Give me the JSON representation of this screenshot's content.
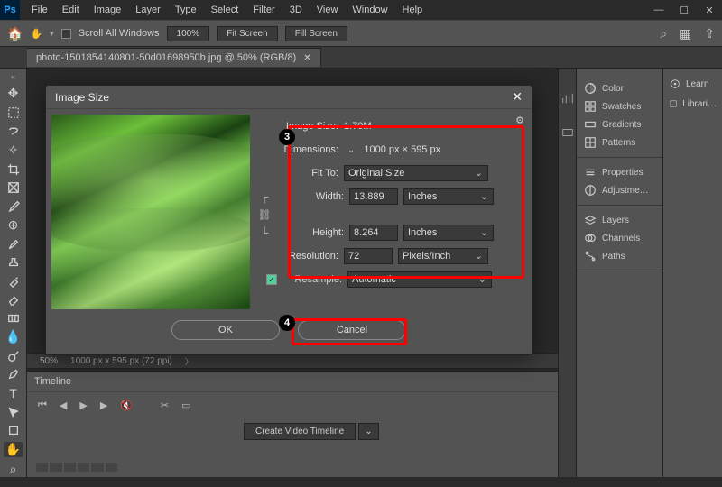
{
  "menu": [
    "File",
    "Edit",
    "Image",
    "Layer",
    "Type",
    "Select",
    "Filter",
    "3D",
    "View",
    "Window",
    "Help"
  ],
  "optbar": {
    "scroll_all": "Scroll All Windows",
    "zoom": "100%",
    "fit": "Fit Screen",
    "fill": "Fill Screen"
  },
  "tab": {
    "label": "photo-1501854140801-50d01698950b.jpg @ 50% (RGB/8)"
  },
  "dialog": {
    "title": "Image Size",
    "image_size_lbl": "Image Size:",
    "image_size_val": "1.70M",
    "dimensions_lbl": "Dimensions:",
    "dimensions_val": "1000 px × 595 px",
    "fit_lbl": "Fit To:",
    "fit_val": "Original Size",
    "width_lbl": "Width:",
    "width_val": "13.889",
    "height_lbl": "Height:",
    "height_val": "8.264",
    "unit_wh": "Inches",
    "res_lbl": "Resolution:",
    "res_val": "72",
    "res_unit": "Pixels/Inch",
    "resample_lbl": "Resample:",
    "resample_val": "Automatic",
    "ok": "OK",
    "cancel": "Cancel"
  },
  "zoombar": {
    "zoom": "50%",
    "info": "1000 px x 595 px (72 ppi)"
  },
  "timeline": {
    "title": "Timeline",
    "create": "Create Video Timeline"
  },
  "right": {
    "group1": [
      "Color",
      "Swatches",
      "Gradients",
      "Patterns"
    ],
    "group2": [
      "Properties",
      "Adjustme…"
    ],
    "group3": [
      "Layers",
      "Channels",
      "Paths"
    ],
    "side": [
      "Learn",
      "Librari…"
    ]
  },
  "annotations": {
    "n3": "3",
    "n4": "4"
  }
}
